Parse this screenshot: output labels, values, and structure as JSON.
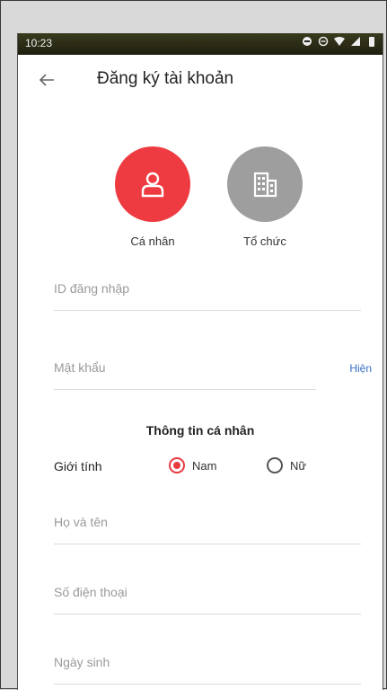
{
  "statusbar": {
    "time": "10:23"
  },
  "appbar": {
    "title": "Đăng ký tài khoản"
  },
  "account_type": {
    "options": [
      {
        "label": "Cá nhân",
        "selected": true,
        "color": "#ee3b41"
      },
      {
        "label": "Tổ chức",
        "selected": false,
        "color": "#9e9e9e"
      }
    ]
  },
  "form": {
    "login_id": {
      "placeholder": "ID đăng nhập"
    },
    "password": {
      "placeholder": "Mật khẩu",
      "show_label": "Hiện"
    },
    "section_title": "Thông tin cá nhân",
    "gender": {
      "label": "Giới tính",
      "male": "Nam",
      "female": "Nữ",
      "selected": "Nam"
    },
    "full_name": {
      "placeholder": "Họ và tên"
    },
    "phone": {
      "placeholder": "Số điện thoại"
    },
    "birthdate": {
      "placeholder": "Ngày sinh"
    }
  },
  "colors": {
    "accent": "#e63a3f",
    "link": "#3a6fc6"
  }
}
